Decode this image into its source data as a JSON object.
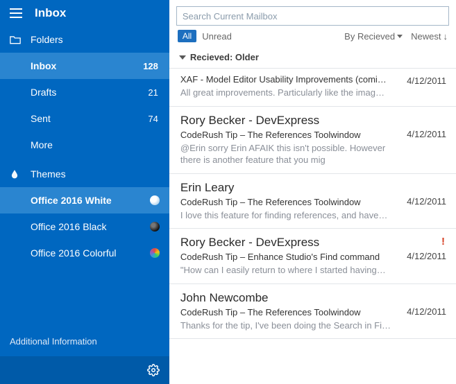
{
  "sidebar": {
    "title": "Inbox",
    "folders_label": "Folders",
    "items": [
      {
        "label": "Inbox",
        "count": "128",
        "selected": true
      },
      {
        "label": "Drafts",
        "count": "21",
        "selected": false
      },
      {
        "label": "Sent",
        "count": "74",
        "selected": false
      },
      {
        "label": "More",
        "count": "",
        "selected": false
      }
    ],
    "themes_label": "Themes",
    "themes": [
      {
        "label": "Office 2016 White",
        "selected": true
      },
      {
        "label": "Office 2016 Black",
        "selected": false
      },
      {
        "label": "Office 2016 Colorful",
        "selected": false
      }
    ],
    "info_label": "Additional Information"
  },
  "search": {
    "placeholder": "Search Current Mailbox"
  },
  "filters": {
    "all": "All",
    "unread": "Unread",
    "sort1": "By Recieved",
    "sort2": "Newest"
  },
  "group": {
    "header": "Recieved: Older"
  },
  "messages": [
    {
      "from": "",
      "subject": "XAF - Model Editor Usability Improvements (comi…",
      "preview": "All great improvements. Particularly like the imag…",
      "date": "4/12/2011",
      "important": false
    },
    {
      "from": "Rory Becker - DevExpress",
      "subject": "CodeRush Tip – The References Toolwindow",
      "preview": "@Erin sorry Erin AFAIK this isn't possible. However there is another feature that you mig",
      "date": "4/12/2011",
      "important": false
    },
    {
      "from": "Erin Leary",
      "subject": "CodeRush Tip – The References Toolwindow",
      "preview": "I love this feature for finding references, and have…",
      "date": "4/12/2011",
      "important": false
    },
    {
      "from": "Rory Becker - DevExpress",
      "subject": "CodeRush Tip – Enhance Studio's Find command",
      "preview": "\"How can I easily return to where I started having…",
      "date": "4/12/2011",
      "important": true
    },
    {
      "from": "John Newcombe",
      "subject": "CodeRush Tip – The References Toolwindow",
      "preview": "Thanks for the tip, I've been doing the Search in Fi…",
      "date": "4/12/2011",
      "important": false
    }
  ]
}
